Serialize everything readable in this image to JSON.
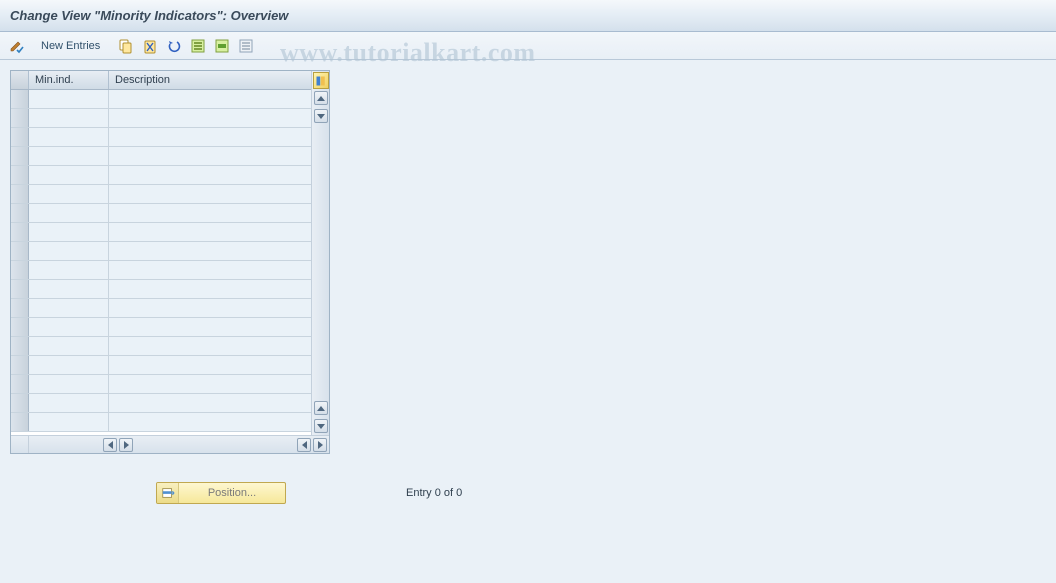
{
  "title": "Change View \"Minority Indicators\": Overview",
  "toolbar": {
    "new_entries_label": "New Entries"
  },
  "table": {
    "columns": {
      "col1": "Min.ind.",
      "col2": "Description"
    }
  },
  "footer": {
    "position_label": "Position...",
    "entry_text": "Entry 0 of 0"
  },
  "watermark": "www.tutorialkart.com"
}
